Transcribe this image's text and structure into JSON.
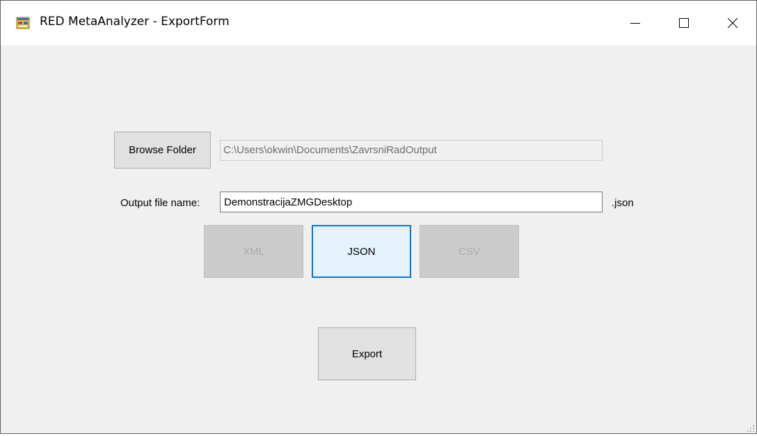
{
  "window": {
    "title": "RED MetaAnalyzer - ExportForm",
    "icon": "app-form-icon",
    "controls": {
      "minimize_icon": "minimize-icon",
      "maximize_icon": "maximize-icon",
      "close_icon": "close-icon"
    }
  },
  "form": {
    "browse_button_label": "Browse Folder",
    "folder_path_value": "C:\\Users\\okwin\\Documents\\ZavrsniRadOutput",
    "output_label": "Output file name:",
    "output_filename_value": "DemonstracijaZMGDesktop",
    "extension_label": ".json",
    "format_buttons": {
      "xml_label": "XML",
      "json_label": "JSON",
      "csv_label": "CSV"
    },
    "export_button_label": "Export"
  },
  "colors": {
    "focus_border": "#0078d7",
    "window_background": "#f0f0f0",
    "disabled_text": "#a8a8a8"
  }
}
